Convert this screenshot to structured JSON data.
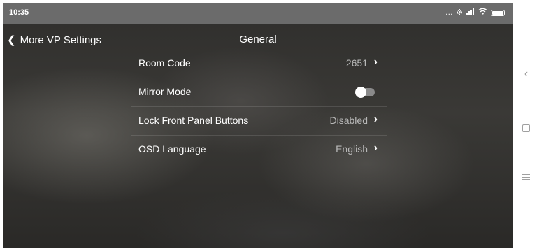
{
  "status_bar": {
    "time": "10:35",
    "icons": [
      "dots-icon",
      "bluetooth-icon",
      "signal-icon",
      "wifi-icon",
      "battery-icon"
    ]
  },
  "header": {
    "back_label": "More VP Settings",
    "title": "General"
  },
  "settings": {
    "items": [
      {
        "label": "Room Code",
        "value": "2651",
        "control": "chevron"
      },
      {
        "label": "Mirror Mode",
        "value": "",
        "control": "toggle",
        "state": "off"
      },
      {
        "label": "Lock Front Panel Buttons",
        "value": "Disabled",
        "control": "chevron"
      },
      {
        "label": "OSD Language",
        "value": "English",
        "control": "chevron"
      }
    ]
  },
  "nav_bar": {
    "buttons": [
      "back",
      "home",
      "menu"
    ]
  },
  "colors": {
    "status_bar": "#6b6b6b",
    "value_text": "#b8b8b8",
    "toggle_track": "#8a8a8a"
  }
}
